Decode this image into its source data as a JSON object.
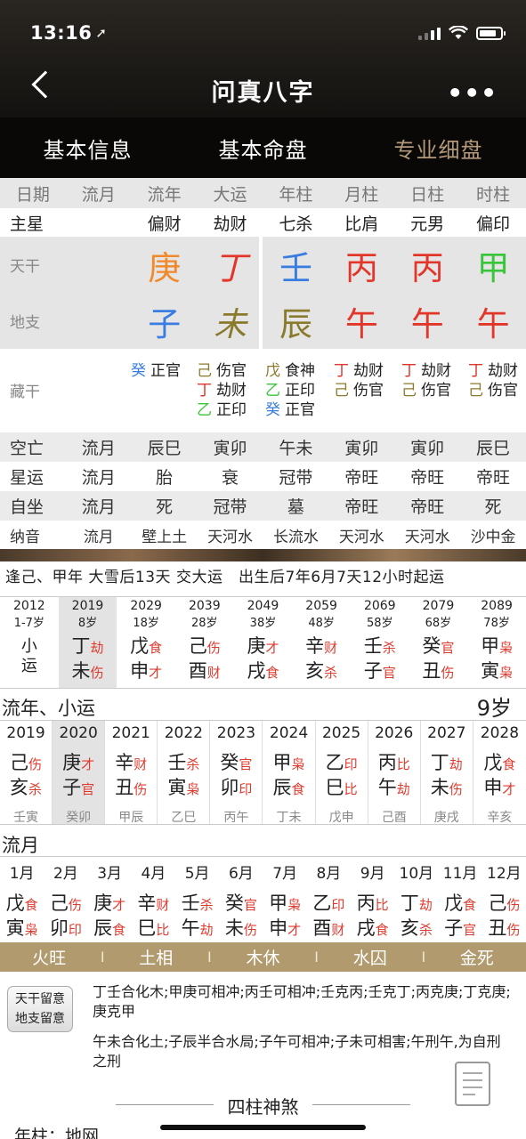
{
  "status": {
    "time": "13:16",
    "location_icon": "location-arrow-icon"
  },
  "nav": {
    "title": "问真八字",
    "back_icon": "chevron-left-icon",
    "more_icon": "more-dots-icon"
  },
  "tabs": [
    "基本信息",
    "基本命盘",
    "专业细盘"
  ],
  "header": [
    "日期",
    "流月",
    "流年",
    "大运",
    "年柱",
    "月柱",
    "日柱",
    "时柱"
  ],
  "zhuxing": {
    "label": "主星",
    "values": [
      "",
      "偏财",
      "劫财",
      "七杀",
      "比肩",
      "元男",
      "偏印"
    ]
  },
  "tiangan": {
    "label": "天干",
    "values": [
      "",
      "庚",
      "丁",
      "壬",
      "丙",
      "丙",
      "甲"
    ]
  },
  "dizhi": {
    "label": "地支",
    "values": [
      "",
      "子",
      "未",
      "辰",
      "午",
      "午",
      "午"
    ]
  },
  "canggan": {
    "label": "藏干",
    "liunian": [
      {
        "c": "癸",
        "s": "正官"
      }
    ],
    "dayun": [
      {
        "c": "己",
        "s": "伤官"
      },
      {
        "c": "丁",
        "s": "劫财"
      },
      {
        "c": "乙",
        "s": "正印"
      }
    ],
    "nian": [
      {
        "c": "戊",
        "s": "食神"
      },
      {
        "c": "乙",
        "s": "正印"
      },
      {
        "c": "癸",
        "s": "正官"
      }
    ],
    "yue": [
      {
        "c": "丁",
        "s": "劫财"
      },
      {
        "c": "己",
        "s": "伤官"
      }
    ],
    "ri": [
      {
        "c": "丁",
        "s": "劫财"
      },
      {
        "c": "己",
        "s": "伤官"
      }
    ],
    "shi": [
      {
        "c": "丁",
        "s": "劫财"
      },
      {
        "c": "己",
        "s": "伤官"
      }
    ]
  },
  "kongwang": {
    "label": "空亡",
    "values": [
      "流月",
      "辰巳",
      "寅卯",
      "午未",
      "寅卯",
      "寅卯",
      "辰巳"
    ]
  },
  "xingyun": {
    "label": "星运",
    "values": [
      "流月",
      "胎",
      "衰",
      "冠带",
      "帝旺",
      "帝旺",
      "帝旺"
    ]
  },
  "zizuo": {
    "label": "自坐",
    "values": [
      "流月",
      "死",
      "冠带",
      "墓",
      "帝旺",
      "帝旺",
      "死"
    ]
  },
  "nayin": {
    "label": "纳音",
    "values": [
      "流月",
      "壁上土",
      "天河水",
      "长流水",
      "天河水",
      "天河水",
      "沙中金"
    ]
  },
  "qiyun": "逢己、甲年 大雪后13天 交大运　出生后7年6月7天12小时起运",
  "dayun": [
    {
      "year": "2012",
      "age": "1-7岁",
      "xiao": [
        "小",
        "运"
      ]
    },
    {
      "year": "2019",
      "age": "8岁",
      "g": "丁",
      "gs": "劫",
      "z": "未",
      "zs": "伤"
    },
    {
      "year": "2029",
      "age": "18岁",
      "g": "戊",
      "gs": "食",
      "z": "申",
      "zs": "才"
    },
    {
      "year": "2039",
      "age": "28岁",
      "g": "己",
      "gs": "伤",
      "z": "酉",
      "zs": "财"
    },
    {
      "year": "2049",
      "age": "38岁",
      "g": "庚",
      "gs": "才",
      "z": "戌",
      "zs": "食"
    },
    {
      "year": "2059",
      "age": "48岁",
      "g": "辛",
      "gs": "财",
      "z": "亥",
      "zs": "杀"
    },
    {
      "year": "2069",
      "age": "58岁",
      "g": "壬",
      "gs": "杀",
      "z": "子",
      "zs": "官"
    },
    {
      "year": "2079",
      "age": "68岁",
      "g": "癸",
      "gs": "官",
      "z": "丑",
      "zs": "伤"
    },
    {
      "year": "2089",
      "age": "78岁",
      "g": "甲",
      "gs": "枭",
      "z": "寅",
      "zs": "枭"
    }
  ],
  "liunian_title": "流年、小运",
  "age_now": "9岁",
  "liunian": [
    {
      "year": "2019",
      "g": "己",
      "gs": "伤",
      "z": "亥",
      "zs": "杀",
      "gz": "壬寅"
    },
    {
      "year": "2020",
      "g": "庚",
      "gs": "才",
      "z": "子",
      "zs": "官",
      "gz": "癸卯"
    },
    {
      "year": "2021",
      "g": "辛",
      "gs": "财",
      "z": "丑",
      "zs": "伤",
      "gz": "甲辰"
    },
    {
      "year": "2022",
      "g": "壬",
      "gs": "杀",
      "z": "寅",
      "zs": "枭",
      "gz": "乙巳"
    },
    {
      "year": "2023",
      "g": "癸",
      "gs": "官",
      "z": "卯",
      "zs": "印",
      "gz": "丙午"
    },
    {
      "year": "2024",
      "g": "甲",
      "gs": "枭",
      "z": "辰",
      "zs": "食",
      "gz": "丁未"
    },
    {
      "year": "2025",
      "g": "乙",
      "gs": "印",
      "z": "巳",
      "zs": "比",
      "gz": "戊申"
    },
    {
      "year": "2026",
      "g": "丙",
      "gs": "比",
      "z": "午",
      "zs": "劫",
      "gz": "己酉"
    },
    {
      "year": "2027",
      "g": "丁",
      "gs": "劫",
      "z": "未",
      "zs": "伤",
      "gz": "庚戌"
    },
    {
      "year": "2028",
      "g": "戊",
      "gs": "食",
      "z": "申",
      "zs": "才",
      "gz": "辛亥"
    }
  ],
  "liuyue_title": "流月",
  "liuyue": [
    {
      "m": "1月",
      "g": "戊",
      "gs": "食",
      "z": "寅",
      "zs": "枭"
    },
    {
      "m": "2月",
      "g": "己",
      "gs": "伤",
      "z": "卯",
      "zs": "印"
    },
    {
      "m": "3月",
      "g": "庚",
      "gs": "才",
      "z": "辰",
      "zs": "食"
    },
    {
      "m": "4月",
      "g": "辛",
      "gs": "财",
      "z": "巳",
      "zs": "比"
    },
    {
      "m": "5月",
      "g": "壬",
      "gs": "杀",
      "z": "午",
      "zs": "劫"
    },
    {
      "m": "6月",
      "g": "癸",
      "gs": "官",
      "z": "未",
      "zs": "伤"
    },
    {
      "m": "7月",
      "g": "甲",
      "gs": "枭",
      "z": "申",
      "zs": "才"
    },
    {
      "m": "8月",
      "g": "乙",
      "gs": "印",
      "z": "酉",
      "zs": "财"
    },
    {
      "m": "9月",
      "g": "丙",
      "gs": "比",
      "z": "戌",
      "zs": "食"
    },
    {
      "m": "10月",
      "g": "丁",
      "gs": "劫",
      "z": "亥",
      "zs": "杀"
    },
    {
      "m": "11月",
      "g": "戊",
      "gs": "食",
      "z": "子",
      "zs": "官"
    },
    {
      "m": "12月",
      "g": "己",
      "gs": "伤",
      "z": "丑",
      "zs": "伤"
    }
  ],
  "wuxing": [
    "火旺",
    "土相",
    "木休",
    "水囚",
    "金死"
  ],
  "notes": {
    "button": [
      "天干留意",
      "地支留意"
    ],
    "tiangan": "丁壬合化木;甲庚可相冲;丙壬可相冲;壬克丙;壬克丁;丙克庚;丁克庚;庚克甲",
    "dizhi": "午未合化土;子辰半合水局;子午可相冲;子未可相害;午刑午,为自刑之刑"
  },
  "shensha_title": "四柱神煞",
  "nianzhu": "年柱：地网",
  "colors": {
    "金": "#f0892a",
    "火": "#e3362b",
    "水": "#3a7de0",
    "木": "#39c53a",
    "土": "#8a7a2c",
    "shishen": "#e03a2e",
    "wuxing_bar": "#b09a6e",
    "tab_active": "#b3987a"
  }
}
